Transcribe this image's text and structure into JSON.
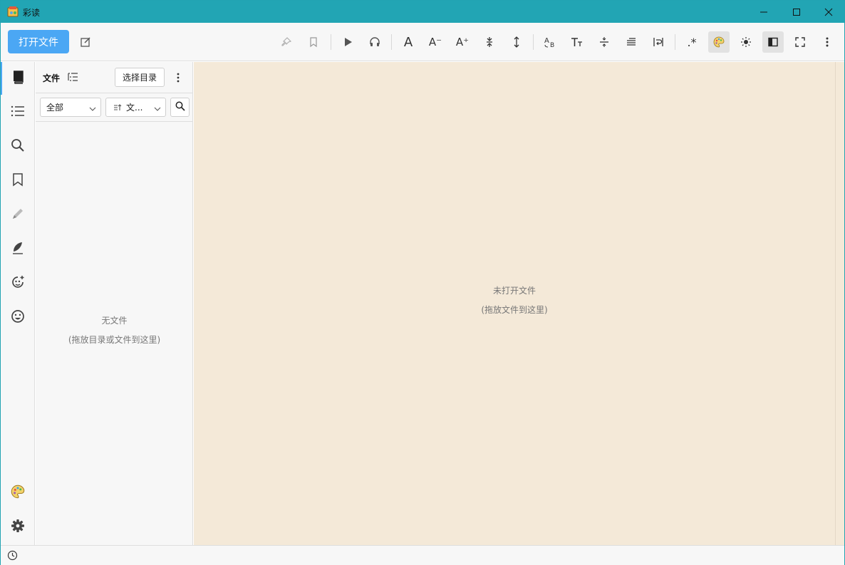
{
  "window": {
    "title": "彩读"
  },
  "toolbar": {
    "open_label": "打开文件",
    "items": [
      "edit-icon",
      "pin-icon",
      "bookmark-icon",
      "play-icon",
      "headphones-icon",
      "font-icon",
      "font-decrease-icon",
      "font-increase-icon",
      "line-compress-icon",
      "line-expand-icon",
      "convert-icon",
      "text-size-icon",
      "divider-icon",
      "align-icon",
      "wrap-icon",
      "regex-icon",
      "palette-icon",
      "brightness-icon",
      "sidebar-toggle-icon",
      "fullscreen-icon",
      "more-icon"
    ],
    "regex_glyph": ".*",
    "font_glyph": "A",
    "font_minus_glyph": "A⁻",
    "font_plus_glyph": "A⁺"
  },
  "sidebar": {
    "items": [
      "library-icon",
      "toc-icon",
      "search-icon",
      "bookmark-icon",
      "highlight-icon",
      "note-icon",
      "ai-icon",
      "emoji-icon"
    ],
    "bottom": [
      "palette-icon",
      "settings-icon"
    ]
  },
  "file_panel": {
    "title": "文件",
    "choose_dir": "选择目录",
    "filter_all": "全部",
    "sort_label": "文...",
    "empty_title": "无文件",
    "empty_hint": "(拖放目录或文件到这里)"
  },
  "reader": {
    "empty_title": "未打开文件",
    "empty_hint": "(拖放文件到这里)",
    "background": "#f4e9d8"
  },
  "colors": {
    "titlebar": "#22a5b4",
    "accent": "#4ba7f4"
  }
}
